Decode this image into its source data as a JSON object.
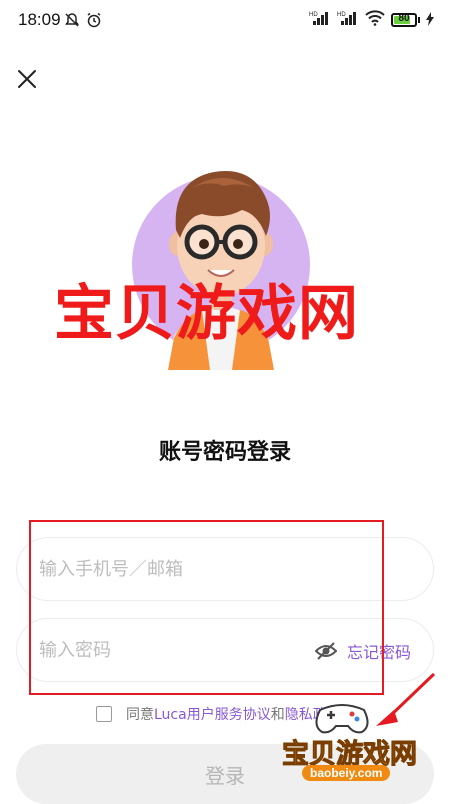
{
  "status_bar": {
    "time": "18:09",
    "battery": "80",
    "battery_level": 0.8,
    "icons": [
      "mute-bell-icon",
      "alarm-icon",
      "signal-hd-icon",
      "signal-hd-icon",
      "wifi-icon",
      "battery-icon",
      "charging-icon"
    ]
  },
  "watermark": {
    "text": "宝贝游戏网"
  },
  "login": {
    "title": "账号密码登录",
    "phone_placeholder": "输入手机号／邮箱",
    "password_placeholder": "输入密码",
    "forgot_label": "忘记密码",
    "agree_prefix": "同意",
    "agreement_link": "Luca用户服务协议",
    "agree_and": "和",
    "privacy_link": "隐私政策",
    "login_button": "登录"
  },
  "site_logo": {
    "name": "宝贝游戏网",
    "url": "baobeiy.com"
  },
  "colors": {
    "accent": "#8a58d6",
    "avatar_bg": "#d6b3f1",
    "watermark": "#ef1b1b",
    "annotation_box": "#e41b22"
  }
}
